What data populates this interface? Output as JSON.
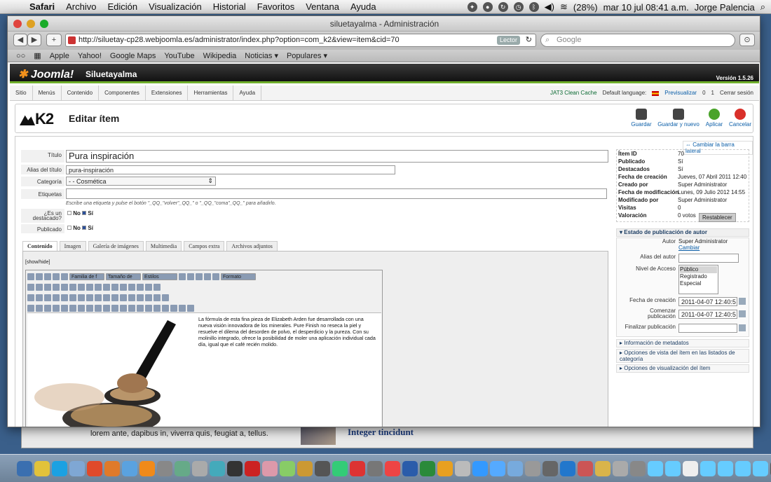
{
  "menubar": {
    "items": [
      "Safari",
      "Archivo",
      "Edición",
      "Visualización",
      "Historial",
      "Favoritos",
      "Ventana",
      "Ayuda"
    ],
    "battery": "(28%)",
    "datetime": "mar 10 jul  08:41 a.m.",
    "user": "Jorge Palencia"
  },
  "browser": {
    "title": "siluetayalma - Administración",
    "url": "http://siluetay-cp28.webjoomla.es/administrator/index.php?option=com_k2&view=item&cid=70",
    "reader": "Lector",
    "search_placeholder": "Google",
    "bookmarks": [
      "Apple",
      "Yahoo!",
      "Google Maps",
      "YouTube",
      "Wikipedia",
      "Noticias ▾",
      "Populares ▾"
    ]
  },
  "joomla": {
    "logo": "Joomla!",
    "site": "Siluetayalma",
    "version": "Versión 1.5.26",
    "menu": [
      "Sitio",
      "Menús",
      "Contenido",
      "Componentes",
      "Extensiones",
      "Herramientas",
      "Ayuda"
    ],
    "status": {
      "clean_cache": "JAT3 Clean Cache",
      "default_lang": "Default language:",
      "preview": "Previsualizar",
      "msgs": "0",
      "users": "1",
      "logout": "Cerrar sesión"
    }
  },
  "k2": {
    "logo": "K2",
    "page_title": "Editar ítem",
    "buttons": {
      "save": "Guardar",
      "save_new": "Guardar y nuevo",
      "apply": "Aplicar",
      "cancel": "Cancelar"
    }
  },
  "form": {
    "title_label": "Título",
    "title_value": "Pura inspiración",
    "alias_label": "Alias del título",
    "alias_value": "pura-inspiración",
    "category_label": "Categoría",
    "category_value": "- - Cosmética",
    "tags_label": "Etiquetas",
    "tags_hint": "Escribe una etiqueta y pulse el botón \"_QQ_\"volver\"_QQ_\" o \"_QQ_\"coma\"_QQ_\" para añadirlo.",
    "featured_label": "¿Es un destacado?",
    "published_label": "Publicado",
    "no": "No",
    "yes": "Sí"
  },
  "tabs": [
    "Contenido",
    "Imagen",
    "Galería de imágenes",
    "Multimedia",
    "Campos extra",
    "Archivos adjuntos"
  ],
  "editor": {
    "toggle": "[show/hide]",
    "font_family": "Familia de f",
    "font_size": "Tamaño de",
    "styles": "Estilos",
    "format": "Formato",
    "text": "La fórmula de esta fina pieza de Elizabeth Arden fue desarrollada con una nueva visión innovadora de los minerales. Pure Finish no reseca la piel y resuelve el dilema del desorden de polvo, el desperdicio y la pureza. Con su molinillo integrado, ofrece la posibilidad de moler una aplicación individual cada día, igual que el café recién molido."
  },
  "sidebar": {
    "toggle": "Cambiar la barra lateral",
    "info": [
      {
        "k": "Ítem ID",
        "v": "70"
      },
      {
        "k": "Publicado",
        "v": "Sí"
      },
      {
        "k": "Destacados",
        "v": "Sí"
      },
      {
        "k": "Fecha de creación",
        "v": "Jueves, 07 Abril 2011 12:40"
      },
      {
        "k": "Creado por",
        "v": "Super Administrator"
      },
      {
        "k": "Fecha de modificación",
        "v": "Lunes, 09 Julio 2012 14:55"
      },
      {
        "k": "Modificado por",
        "v": "Super Administrator"
      },
      {
        "k": "Visitas",
        "v": "0"
      },
      {
        "k": "Valoración",
        "v": "0 votos"
      }
    ],
    "reset": "Restablecer",
    "author_section": "Estado de publicación de autor",
    "author_label": "Autor",
    "author_value": "Super Administrator",
    "author_change": "Cambiar",
    "alias_label": "Alias del autor",
    "access_label": "Nivel de Acceso",
    "access_options": [
      "Público",
      "Registrado",
      "Especial"
    ],
    "created_label": "Fecha de creación",
    "created_value": "2011-04-07 12:40:5",
    "start_label": "Comenzar publicación",
    "start_value": "2011-04-07 12:40:5",
    "end_label": "Finalizar publicación",
    "meta": "Información de metadatos",
    "view_opts": "Opciones de vista del ítem en las listados de categoría",
    "display_opts": "Opciones de visualización del ítem"
  },
  "background": {
    "t1": "lorem ante, dapibus in, viverra quis, feugiat a, tellus.",
    "t2": "Integer tincidunt"
  }
}
